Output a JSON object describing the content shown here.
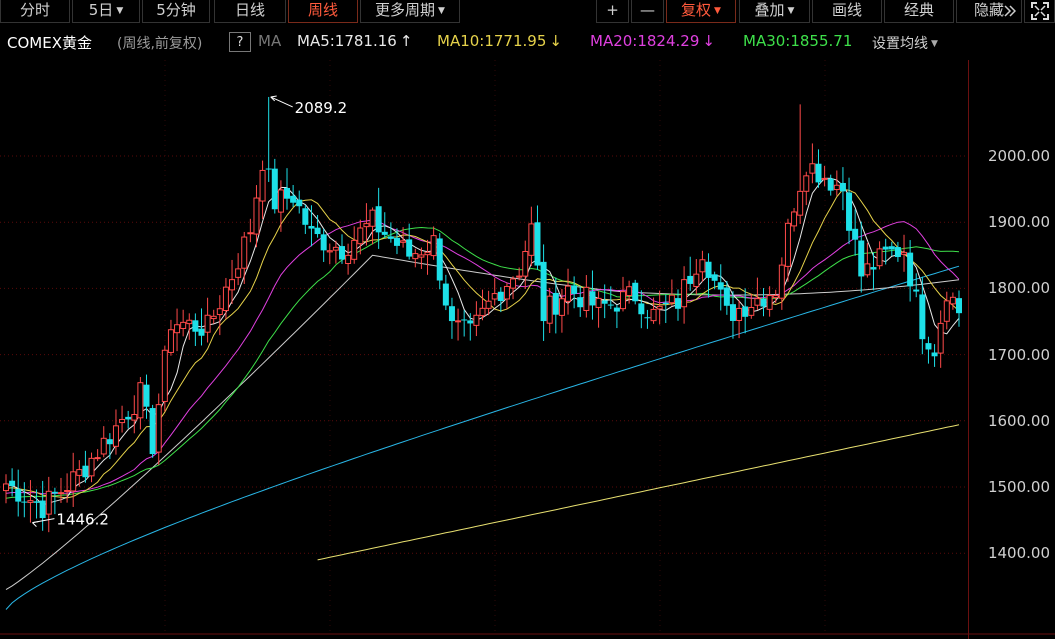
{
  "toolbar": {
    "left_tabs": [
      {
        "label": "分时",
        "caret": false,
        "active": false
      },
      {
        "label": "5日",
        "caret": true,
        "active": false
      },
      {
        "label": "5分钟",
        "caret": false,
        "active": false
      },
      {
        "label": "日线",
        "caret": false,
        "active": false
      },
      {
        "label": "周线",
        "caret": false,
        "active": true
      },
      {
        "label": "更多周期",
        "caret": true,
        "active": false
      }
    ],
    "right_tabs": [
      {
        "label": "+",
        "caret": false,
        "active": false
      },
      {
        "label": "—",
        "caret": false,
        "active": false
      },
      {
        "label": "复权",
        "caret": true,
        "active": true
      },
      {
        "label": "叠加",
        "caret": true,
        "active": false
      },
      {
        "label": "画线",
        "caret": false,
        "active": false
      },
      {
        "label": "经典",
        "caret": false,
        "active": false
      },
      {
        "label": "隐藏",
        "caret": false,
        "active": false
      }
    ],
    "expand_icon": "double-chevron-right-icon",
    "fullscreen_icon": "fullscreen-icon"
  },
  "legend": {
    "title": "COMEX黄金",
    "subtitle": "(周线,前复权)",
    "help": "?",
    "ma_label": "MA",
    "ma5": "MA5:1781.16",
    "ma5_arrow": "↑",
    "ma10": "MA10:1771.95",
    "ma10_arrow": "↓",
    "ma20": "MA20:1824.29",
    "ma20_arrow": "↓",
    "ma30": "MA30:1855.71",
    "settings": "设置均线"
  },
  "chart_data": {
    "type": "candlestick",
    "y_axis_labels": [
      "2000.00",
      "1900.00",
      "1800.00",
      "1700.00",
      "1600.00",
      "1500.00",
      "1400.00"
    ],
    "y_axis_values": [
      2000,
      1900,
      1800,
      1700,
      1600,
      1500,
      1400
    ],
    "ylim": [
      1290,
      2136
    ],
    "annotations": [
      {
        "text": "2089.2",
        "value": 2089.2,
        "kind": "high"
      },
      {
        "text": "1446.2",
        "value": 1446.2,
        "kind": "low"
      }
    ],
    "colors": {
      "up": "#ff4a4a",
      "down": "#1de0e8",
      "ma5": "#e8e8e8",
      "ma10": "#e6d24a",
      "ma20": "#e040e0",
      "ma30": "#3ee04a",
      "ma60": "#cccccc",
      "ma120": "#29b6e6",
      "ma250": "#e8e070",
      "grid": "#5a0a0a"
    }
  }
}
